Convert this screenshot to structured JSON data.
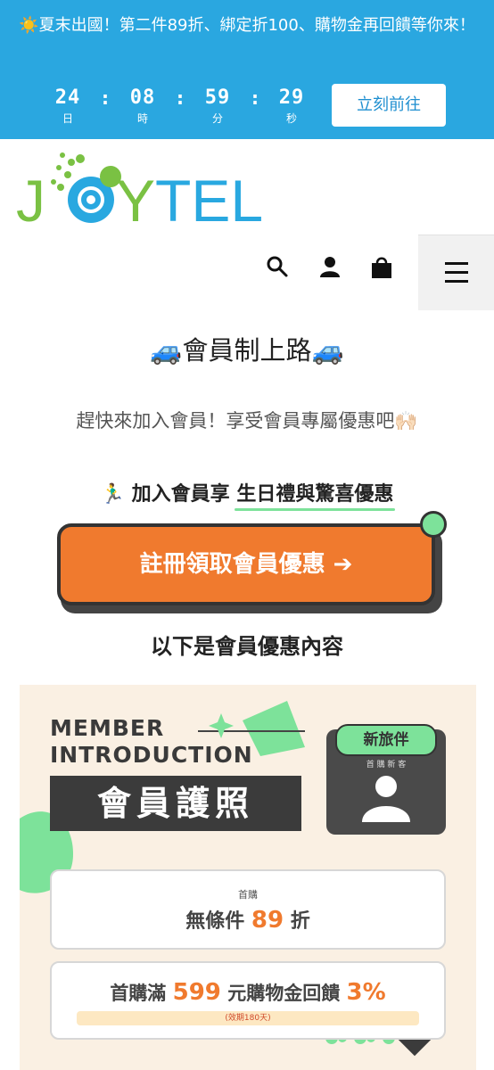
{
  "announcement": {
    "text": "☀️夏末出國！第二件89折、綁定折100、購物金再回饋等你來！",
    "countdown": [
      {
        "value": "24",
        "unit": "日"
      },
      {
        "value": "08",
        "unit": "時"
      },
      {
        "value": "59",
        "unit": "分"
      },
      {
        "value": "29",
        "unit": "秒"
      }
    ],
    "separator": ":",
    "cta_label": "立刻前往"
  },
  "header": {
    "logo_text": "JOYTEL",
    "icons": [
      "search-icon",
      "account-icon",
      "cart-icon",
      "menu-icon"
    ]
  },
  "main": {
    "heading": "🚙會員制上路🚙",
    "subtitle": "趕快來加入會員！享受會員專屬優惠吧🙌🏻",
    "join_prefix": "🏃‍♂️ 加入會員享 ",
    "join_highlight": "生日禮與驚喜優惠",
    "register_label": "註冊領取會員優惠 ➔",
    "below_label": "以下是會員優惠內容"
  },
  "banner": {
    "title_line1": "MEMBER",
    "title_line2": "INTRODUCTION",
    "title_cn": "會員護照",
    "card_tag": "新旅伴",
    "card_sub": "首 購 新 客",
    "offer1_small": "首購",
    "offer1_prefix": "無條件 ",
    "offer1_value": "89",
    "offer1_suffix": " 折",
    "offer2_prefix": "首購滿 ",
    "offer2_value": "599",
    "offer2_middle": " 元購物金回饋 ",
    "offer2_pct": "3%",
    "offer2_note": "(效期180天)"
  },
  "colors": {
    "announcement_bg": "#2aa7e0",
    "brand_green": "#7ac143",
    "brand_blue": "#29a8e0",
    "register_orange": "#f07a2e",
    "accent_mint": "#7de29a"
  }
}
